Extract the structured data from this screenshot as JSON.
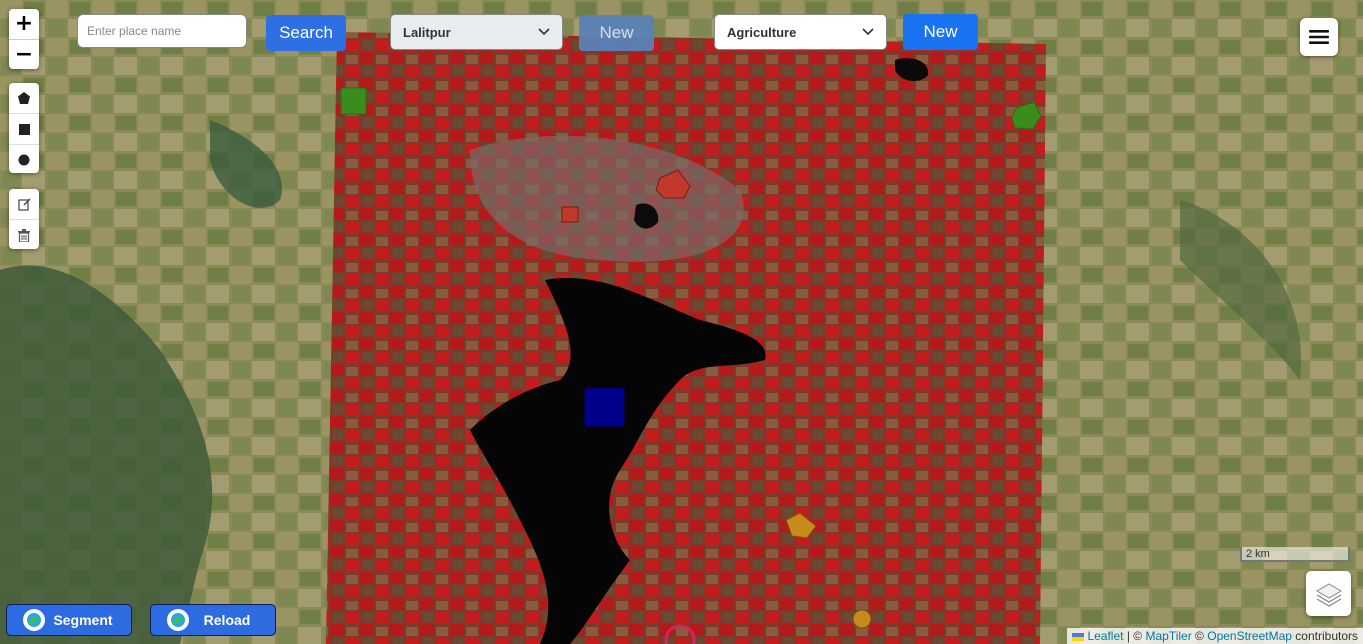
{
  "search": {
    "placeholder": "Enter place name",
    "button_label": "Search"
  },
  "district_select": {
    "value": "Lalitpur"
  },
  "new_district_button": "New",
  "class_select": {
    "value": "Agriculture"
  },
  "new_class_button": "New",
  "zoom": {
    "in": "+",
    "out": "−"
  },
  "draw_tools": [
    "polygon-icon",
    "rectangle-icon",
    "circle-icon"
  ],
  "edit_tools": [
    "edit-icon",
    "trash-icon"
  ],
  "scale": {
    "label": "2 km"
  },
  "attribution": {
    "leaflet": "Leaflet",
    "sep1": "| ©",
    "maptiler": "MapTiler",
    "sep2": "©",
    "osm": "OpenStreetMap",
    "suffix": "contributors"
  },
  "actions": {
    "segment": "Segment",
    "reload": "Reload"
  },
  "colors": {
    "accent": "#2e6fe4",
    "water": "#00008b",
    "forest": "#3a8c1c",
    "urban": "#c0392b",
    "agriculture": "#c98a1c"
  }
}
